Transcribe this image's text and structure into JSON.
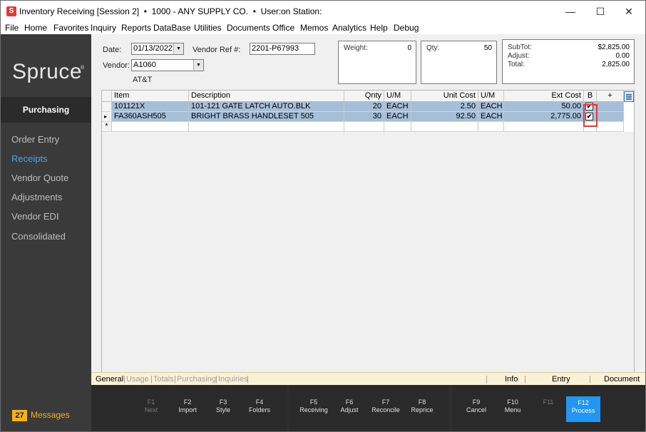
{
  "window": {
    "title": "Inventory Receiving [Session 2]  •  1000 - ANY SUPPLY CO.  •  User:",
    "station": "on Station:",
    "icon_letter": "S",
    "minimize": "—",
    "maximize": "☐",
    "close": "✕"
  },
  "menu": [
    "File",
    "Home",
    "Favorites",
    "Inquiry",
    "Reports",
    "DataBase",
    "Utilities",
    "Documents",
    "Office",
    "Memos",
    "Analytics",
    "Help",
    "Debug"
  ],
  "sidebar": {
    "logo": "Spruce",
    "logo_mark": "®",
    "module": "Purchasing",
    "items": [
      "Order Entry",
      "Receipts",
      "Vendor Quote",
      "Adjustments",
      "Vendor EDI",
      "Consolidated"
    ],
    "active_item": "Receipts",
    "messages_count": "27",
    "messages_label": "Messages"
  },
  "form": {
    "date_label": "Date:",
    "date_value": "01/13/2022",
    "vendor_ref_label": "Vendor Ref #:",
    "vendor_ref_value": "2201-P67993",
    "vendor_label": "Vendor:",
    "vendor_value": "A1060",
    "vendor_name": "AT&T",
    "weight_label": "Weight:",
    "weight_value": "0",
    "qty_label": "Qty:",
    "qty_value": "50",
    "subtot_label": "SubTot:",
    "subtot_value": "$2,825.00",
    "adjust_label": "Adjust:",
    "adjust_value": "0.00",
    "total_label": "Total:",
    "total_value": "2,825.00"
  },
  "grid": {
    "columns": [
      "Item",
      "Description",
      "Qnty",
      "U/M",
      "Unit Cost",
      "U/M",
      "Ext Cost",
      "B",
      "+"
    ],
    "rows": [
      {
        "item": "101121X",
        "description": "101-121 GATE LATCH AUTO.BLK",
        "qnty": "20",
        "um": "EACH",
        "unit_cost": "2.50",
        "um2": "EACH",
        "ext_cost": "50.00",
        "b": "✔"
      },
      {
        "item": "FA360ASH505",
        "description": "BRIGHT BRASS HANDLESET 505",
        "qnty": "30",
        "um": "EACH",
        "unit_cost": "92.50",
        "um2": "EACH",
        "ext_cost": "2,775.00",
        "b": "✔"
      }
    ],
    "current_row_marker": "▸",
    "new_row_marker": "*"
  },
  "tabs": {
    "left": [
      "General",
      "Usage",
      "Totals",
      "Purchasing",
      "Inquiries"
    ],
    "active": "General",
    "separator": "|",
    "right": [
      "Info",
      "Entry",
      "Document"
    ]
  },
  "fkeys": [
    {
      "key": "F1",
      "label": "Next"
    },
    {
      "key": "F2",
      "label": "Import"
    },
    {
      "key": "F3",
      "label": "Style"
    },
    {
      "key": "F4",
      "label": "Folders"
    },
    {
      "key": "F5",
      "label": "Receiving"
    },
    {
      "key": "F6",
      "label": "Adjust"
    },
    {
      "key": "F7",
      "label": "Reconcile"
    },
    {
      "key": "F8",
      "label": "Reprice"
    },
    {
      "key": "F9",
      "label": "Cancel"
    },
    {
      "key": "F10",
      "label": "Menu"
    },
    {
      "key": "F11",
      "label": ""
    },
    {
      "key": "F12",
      "label": "Process"
    }
  ],
  "colors": {
    "sidebar_bg": "#3a3a3a",
    "accent_blue": "#2196f3",
    "selected_row": "#a6bed8",
    "highlight_red": "#e53935",
    "messages_yellow": "#f5b01b"
  }
}
